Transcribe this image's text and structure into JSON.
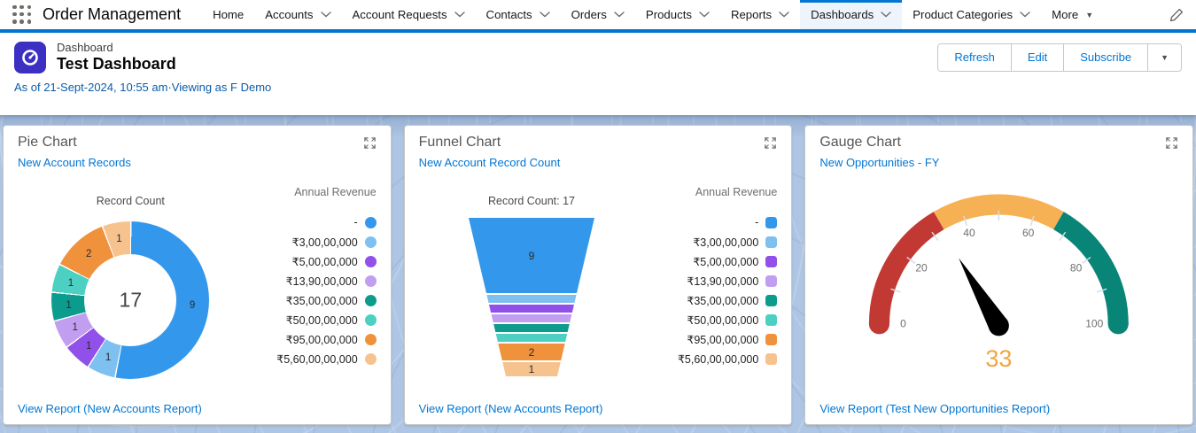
{
  "nav": {
    "app_name": "Order Management",
    "tabs": [
      {
        "label": "Home",
        "chevron": false,
        "active": false
      },
      {
        "label": "Accounts",
        "chevron": true,
        "active": false
      },
      {
        "label": "Account Requests",
        "chevron": true,
        "active": false
      },
      {
        "label": "Contacts",
        "chevron": true,
        "active": false
      },
      {
        "label": "Orders",
        "chevron": true,
        "active": false
      },
      {
        "label": "Products",
        "chevron": true,
        "active": false
      },
      {
        "label": "Reports",
        "chevron": true,
        "active": false
      },
      {
        "label": "Dashboards",
        "chevron": true,
        "active": true
      },
      {
        "label": "Product Categories",
        "chevron": true,
        "active": false
      },
      {
        "label": "More",
        "chevron": "filled",
        "active": false
      }
    ]
  },
  "header": {
    "entity_label": "Dashboard",
    "title": "Test Dashboard",
    "meta": "As of 21-Sept-2024, 10:55 am·Viewing as F Demo",
    "buttons": [
      "Refresh",
      "Edit",
      "Subscribe"
    ]
  },
  "colors": {
    "accent": "#0176D3",
    "link": "#0176D3",
    "nav_active_bg": "#EEF4FB",
    "canvas_bg": "#AEC6E4",
    "entity_icon_bg": "#3C30C3"
  },
  "chart_data": [
    {
      "type": "pie",
      "card_title": "Pie Chart",
      "source_link": "New Account Records",
      "title": "Record Count",
      "legend_title": "Annual Revenue",
      "total": 17,
      "segments": [
        {
          "label": "-",
          "value": 9,
          "color": "#3398EB",
          "labeled": true
        },
        {
          "label": "₹3,00,00,000",
          "value": 1,
          "color": "#7EC0F0",
          "labeled": true
        },
        {
          "label": "₹5,00,00,000",
          "value": 1,
          "color": "#9050E9",
          "labeled": true
        },
        {
          "label": "₹13,90,00,000",
          "value": 1,
          "color": "#C29EF1",
          "labeled": true
        },
        {
          "label": "₹35,00,00,000",
          "value": 1,
          "color": "#0C9C8D",
          "labeled": true
        },
        {
          "label": "₹50,00,00,000",
          "value": 1,
          "color": "#4CD0C2",
          "labeled": true
        },
        {
          "label": "₹95,00,00,000",
          "value": 2,
          "color": "#F0913C",
          "labeled": true
        },
        {
          "label": "₹5,60,00,00,000",
          "value": 1,
          "color": "#F6C38E",
          "labeled": true
        }
      ],
      "footer_link": "View Report (New Accounts Report)"
    },
    {
      "type": "funnel",
      "card_title": "Funnel Chart",
      "source_link": "New Account Record Count",
      "title": "Record Count: 17",
      "legend_title": "Annual Revenue",
      "total": 17,
      "segments": [
        {
          "label": "-",
          "value": 9,
          "color": "#3398EB",
          "labeled": true
        },
        {
          "label": "₹3,00,00,000",
          "value": 1,
          "color": "#7EC0F0",
          "labeled": false
        },
        {
          "label": "₹5,00,00,000",
          "value": 1,
          "color": "#9050E9",
          "labeled": false
        },
        {
          "label": "₹13,90,00,000",
          "value": 1,
          "color": "#C29EF1",
          "labeled": false
        },
        {
          "label": "₹35,00,00,000",
          "value": 1,
          "color": "#0C9C8D",
          "labeled": false
        },
        {
          "label": "₹50,00,00,000",
          "value": 1,
          "color": "#4CD0C2",
          "labeled": false
        },
        {
          "label": "₹95,00,00,000",
          "value": 2,
          "color": "#F0913C",
          "labeled": true
        },
        {
          "label": "₹5,60,00,00,000",
          "value": 1,
          "color": "#F6C38E",
          "labeled": true
        }
      ],
      "footer_link": "View Report (New Accounts Report)"
    },
    {
      "type": "gauge",
      "card_title": "Gauge Chart",
      "source_link": "New Opportunities - FY",
      "value": 33,
      "min": 0,
      "max": 100,
      "bands": [
        {
          "from": 0,
          "to": 33.3,
          "color": "#C23934"
        },
        {
          "from": 33.3,
          "to": 66.7,
          "color": "#F7B155"
        },
        {
          "from": 66.7,
          "to": 100,
          "color": "#098577"
        }
      ],
      "tick_labels": [
        0,
        20,
        40,
        60,
        80,
        100
      ],
      "value_color": "#F3A63E",
      "needle_color": "#000000",
      "footer_link": "View Report (Test New Opportunities Report)"
    }
  ]
}
